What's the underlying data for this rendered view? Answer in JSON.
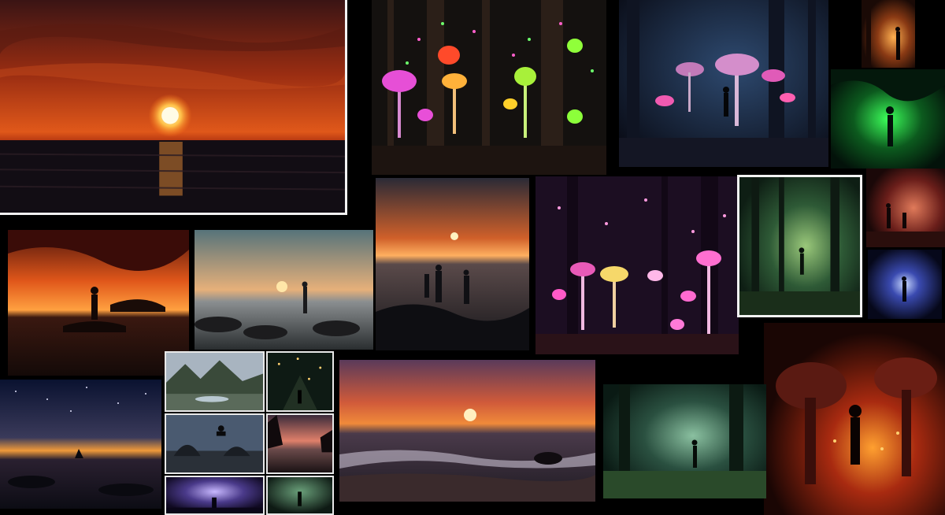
{
  "collage": {
    "background": "#000000",
    "tiles": [
      {
        "name": "ocean-sunset-large",
        "scene": "sunset-sea"
      },
      {
        "name": "glowing-mushroom-forest-green",
        "scene": "mushroom-forest"
      },
      {
        "name": "glowing-mushroom-forest-blue",
        "scene": "mushroom-forest"
      },
      {
        "name": "forest-silhouette-orange-small",
        "scene": "forest-silhouette"
      },
      {
        "name": "forest-silhouette-green-small",
        "scene": "forest-silhouette"
      },
      {
        "name": "sunset-figure-on-rock",
        "scene": "sunset-silhouette"
      },
      {
        "name": "calm-sea-figure",
        "scene": "sunset-sea"
      },
      {
        "name": "sunset-figures-on-shore",
        "scene": "sunset-silhouette"
      },
      {
        "name": "pink-mushroom-forest",
        "scene": "mushroom-forest"
      },
      {
        "name": "misty-green-forest",
        "scene": "forest"
      },
      {
        "name": "forest-silhouette-red-small",
        "scene": "forest-silhouette"
      },
      {
        "name": "blue-glow-figure-small",
        "scene": "forest-silhouette"
      },
      {
        "name": "red-glowing-forest",
        "scene": "forest-silhouette"
      },
      {
        "name": "starry-sea-sunset",
        "scene": "sunset-sea"
      },
      {
        "name": "thumb-mountain-lake",
        "scene": "landscape"
      },
      {
        "name": "thumb-lantern-night",
        "scene": "night"
      },
      {
        "name": "thumb-rock-jump",
        "scene": "sea"
      },
      {
        "name": "thumb-sunset-bay",
        "scene": "sunset-sea"
      },
      {
        "name": "thumb-purple-night",
        "scene": "night"
      },
      {
        "name": "thumb-green-figure",
        "scene": "forest"
      },
      {
        "name": "beach-sunset-waves",
        "scene": "sunset-sea"
      },
      {
        "name": "forest-clearing-figure",
        "scene": "forest"
      }
    ]
  }
}
